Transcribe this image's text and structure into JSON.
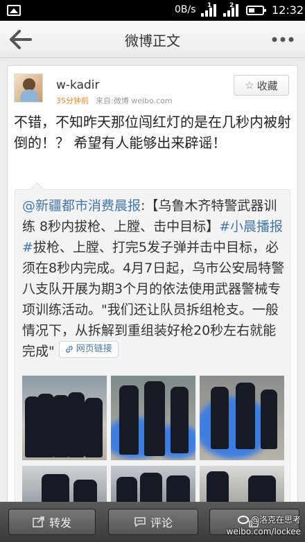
{
  "status_bar": {
    "speed": "0B/s",
    "time": "12:32",
    "sim_labels": [
      "1",
      "2"
    ]
  },
  "header": {
    "title": "微博正文"
  },
  "post": {
    "username": "w-kadir",
    "time": "35分钟前",
    "source": "来自:微博 weibo.com",
    "favorite_label": "收藏",
    "text": "不错，不知昨天那位闯红灯的是在几秒内被射倒的！？ 希望有人能够出来辟谣！"
  },
  "repost": {
    "mention": "@新疆都市消费晨报",
    "text_1": ":【乌鲁木齐特警武器训练 8秒内拔枪、上膛、击中目标】",
    "hashtag": "#小晨播报#",
    "text_2": "拔枪、上膛、打完5发子弹并击中目标，必须在8秒内完成。4月7日起，乌市公安局特警八支队开展为期3个月的依法使用武器警械专项训练活动。\"我们还让队员拆组枪支。一般情况下，从拆解到重组装好枪20秒左右就能完成\"",
    "link_label": "网页链接"
  },
  "photos": [
    {
      "name": "photo-police-row-aiming",
      "alt": "police training"
    },
    {
      "name": "photo-police-blue-smoke-1",
      "alt": "police training"
    },
    {
      "name": "photo-police-blue-smoke-2",
      "alt": "police training"
    },
    {
      "name": "photo-police-indoor-1",
      "alt": "police training"
    },
    {
      "name": "photo-police-indoor-2",
      "alt": "police training"
    },
    {
      "name": "photo-police-indoor-3",
      "alt": "police training"
    }
  ],
  "bottom_bar": {
    "repost_label": "转发",
    "comment_label": "评论"
  },
  "watermark": {
    "handle": "@洛克在思考",
    "url": "weibo.com/lockee"
  },
  "colors": {
    "link": "#4477aa",
    "time_orange": "#f08a24",
    "smoke_blue": "#3e7de0"
  }
}
